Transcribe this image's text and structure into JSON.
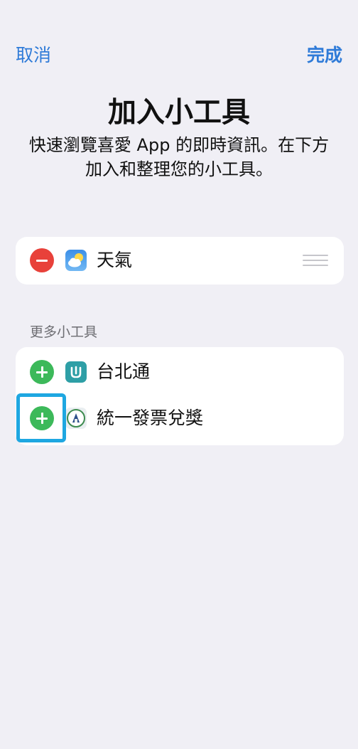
{
  "nav": {
    "cancel_label": "取消",
    "done_label": "完成"
  },
  "header": {
    "title": "加入小工具",
    "subtitle": "快速瀏覽喜愛 App 的即時資訊。在下方加入和整理您的小工具。"
  },
  "active_widgets": [
    {
      "label": "天氣",
      "icon": "weather-icon"
    }
  ],
  "more_section": {
    "header": "更多小工具",
    "items": [
      {
        "label": "台北通",
        "icon": "taipei-pass-icon"
      },
      {
        "label": "統一發票兌獎",
        "icon": "invoice-lottery-icon"
      }
    ]
  },
  "colors": {
    "accent": "#2f7bd8",
    "remove": "#e8413a",
    "add": "#3cb95a",
    "highlight": "#1ea7e1",
    "background": "#f0eff5"
  }
}
